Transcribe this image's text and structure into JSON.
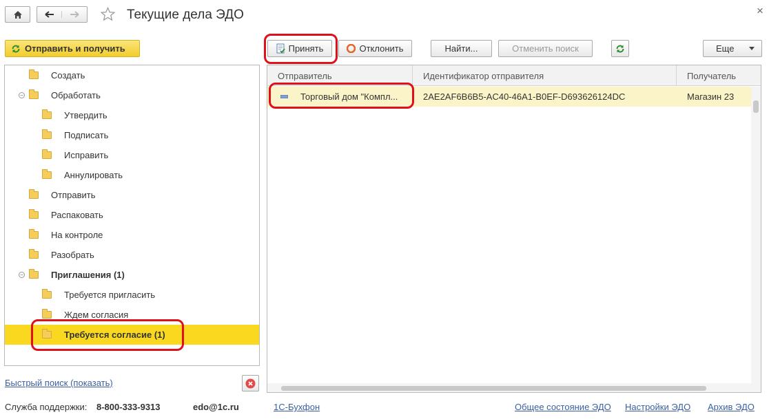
{
  "header": {
    "title": "Текущие дела ЭДО",
    "close_glyph": "×"
  },
  "left_panel": {
    "send_receive_label": "Отправить и получить",
    "tree": [
      {
        "label": "Создать",
        "level": 1,
        "bold": false,
        "expanded": null,
        "selected": false
      },
      {
        "label": "Обработать",
        "level": 1,
        "bold": false,
        "expanded": true,
        "selected": false
      },
      {
        "label": "Утвердить",
        "level": 2,
        "bold": false,
        "expanded": null,
        "selected": false
      },
      {
        "label": "Подписать",
        "level": 2,
        "bold": false,
        "expanded": null,
        "selected": false
      },
      {
        "label": "Исправить",
        "level": 2,
        "bold": false,
        "expanded": null,
        "selected": false
      },
      {
        "label": "Аннулировать",
        "level": 2,
        "bold": false,
        "expanded": null,
        "selected": false
      },
      {
        "label": "Отправить",
        "level": 1,
        "bold": false,
        "expanded": null,
        "selected": false
      },
      {
        "label": "Распаковать",
        "level": 1,
        "bold": false,
        "expanded": null,
        "selected": false
      },
      {
        "label": "На контроле",
        "level": 1,
        "bold": false,
        "expanded": null,
        "selected": false
      },
      {
        "label": "Разобрать",
        "level": 1,
        "bold": false,
        "expanded": null,
        "selected": false
      },
      {
        "label": "Приглашения (1)",
        "level": 1,
        "bold": true,
        "expanded": true,
        "selected": false
      },
      {
        "label": "Требуется пригласить",
        "level": 2,
        "bold": false,
        "expanded": null,
        "selected": false
      },
      {
        "label": "Ждем согласия",
        "level": 2,
        "bold": false,
        "expanded": null,
        "selected": false
      },
      {
        "label": "Требуется согласие (1)",
        "level": 2,
        "bold": true,
        "expanded": null,
        "selected": true
      }
    ],
    "quick_search_label": "Быстрый поиск (показать)"
  },
  "toolbar": {
    "accept_label": "Принять",
    "reject_label": "Отклонить",
    "find_label": "Найти...",
    "cancel_search_label": "Отменить поиск",
    "more_label": "Еще"
  },
  "grid": {
    "columns": [
      "Отправитель",
      "Идентификатор отправителя",
      "Получатель"
    ],
    "rows": [
      {
        "sender": "Торговый дом \"Компл...",
        "sender_id": "2AE2AF6B6B5-AC40-46A1-B0EF-D693626124DC",
        "receiver": "Магазин 23"
      }
    ]
  },
  "footer": {
    "support_label": "Служба поддержки:",
    "phone": "8-800-333-9313",
    "email": "edo@1c.ru",
    "link_buhfon": "1С-Бухфон",
    "link_status": "Общее состояние ЭДО",
    "link_settings": "Настройки ЭДО",
    "link_archive": "Архив ЭДО"
  },
  "colors": {
    "accent_yellow": "#f9d81f",
    "highlight_red": "#e0101a",
    "link_blue": "#3a5fa0"
  }
}
